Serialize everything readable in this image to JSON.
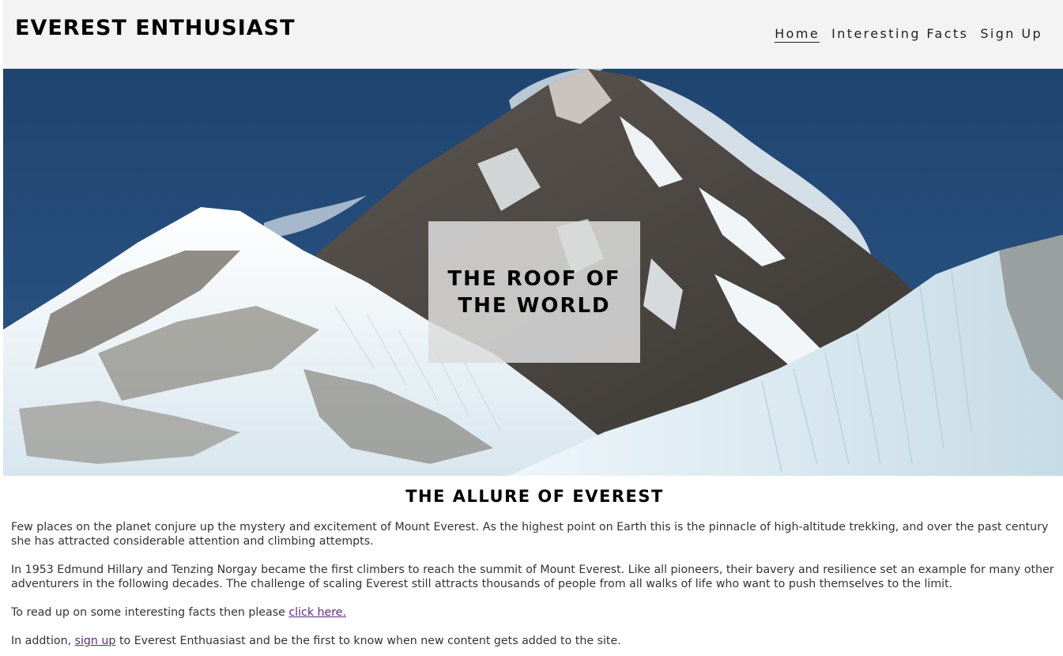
{
  "header": {
    "logo": "EVEREST ENTHUSIAST",
    "nav": [
      {
        "label": "Home",
        "active": true
      },
      {
        "label": "Interesting Facts",
        "active": false
      },
      {
        "label": "Sign Up",
        "active": false
      }
    ]
  },
  "hero": {
    "image": "mountain-everest-photo",
    "title_line1": "THE ROOF OF",
    "title_line2": "THE WORLD"
  },
  "main": {
    "heading": "THE ALLURE OF EVEREST",
    "paragraph1": "Few places on the planet conjure up the mystery and excitement of Mount Everest. As the highest point on Earth this is the pinnacle of high-altitude trekking, and over the past century she has attracted considerable attention and climbing attempts.",
    "paragraph2": "In 1953 Edmund Hillary and Tenzing Norgay became the first climbers to reach the summit of Mount Everest. Like all pioneers, their bavery and resilience set an example for many other adventurers in the following decades. The challenge of scaling Everest still attracts thousands of people from all walks of life who want to push themselves to the limit.",
    "paragraph3_prefix": "To read up on some interesting facts then please ",
    "paragraph3_link": "click here.",
    "paragraph4_prefix": "In addtion, ",
    "paragraph4_link": "sign up",
    "paragraph4_suffix": " to Everest Enthuasiast and be the first to know when new content gets added to the site."
  },
  "colors": {
    "header_bg": "#f3f3f3",
    "sky": "#234a74",
    "link": "#5a2a82"
  }
}
